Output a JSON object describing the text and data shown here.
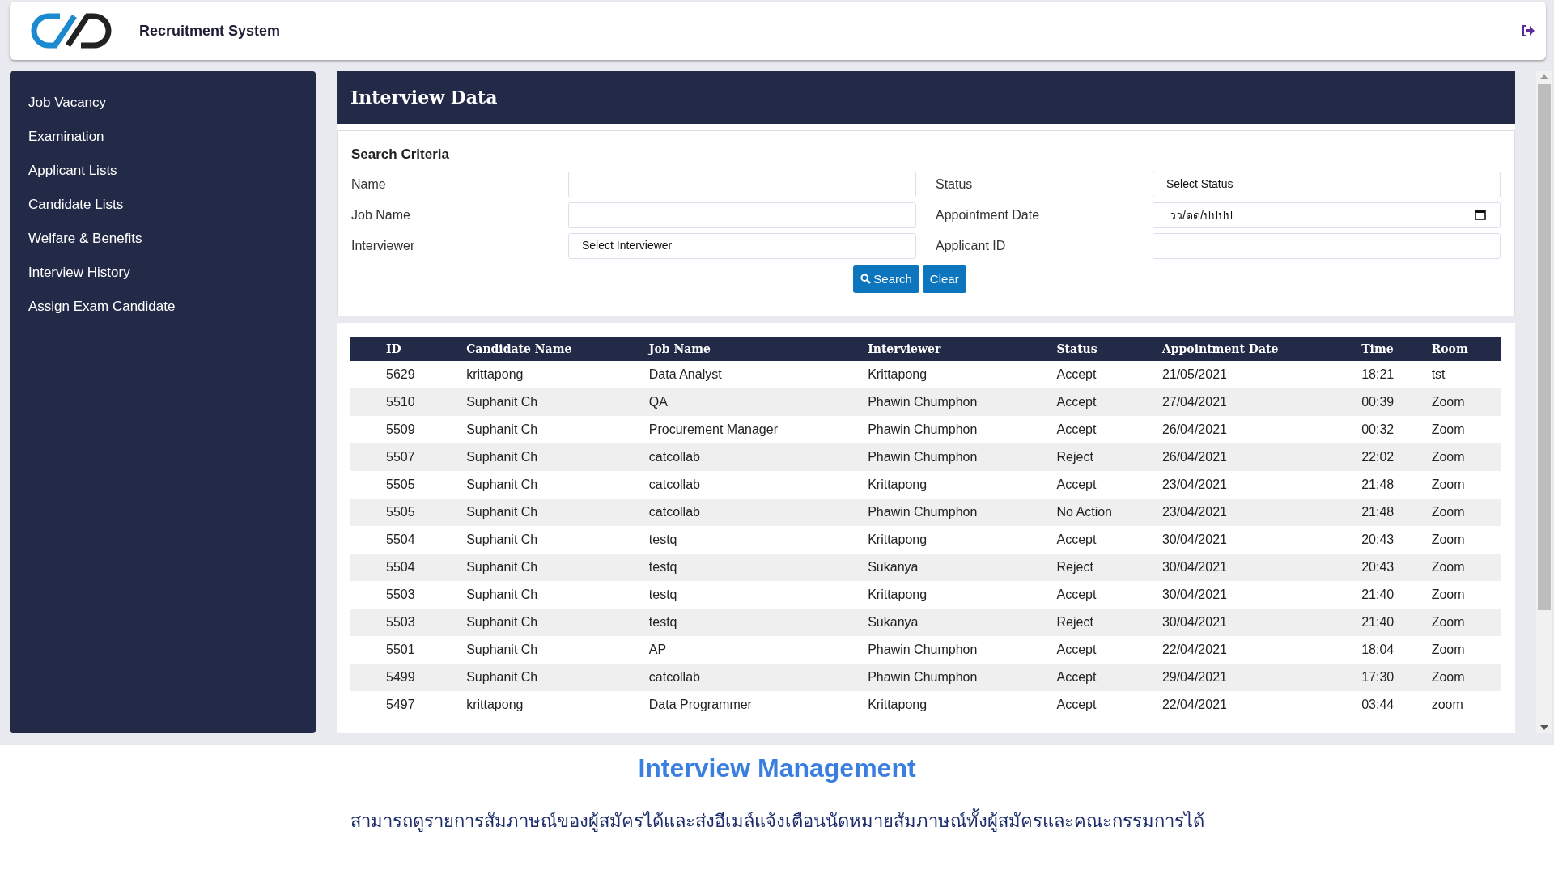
{
  "header": {
    "title": "Recruitment System"
  },
  "sidebar": {
    "items": [
      {
        "label": "Job Vacancy"
      },
      {
        "label": "Examination"
      },
      {
        "label": "Applicant Lists"
      },
      {
        "label": "Candidate Lists"
      },
      {
        "label": "Welfare & Benefits"
      },
      {
        "label": "Interview History"
      },
      {
        "label": "Assign Exam Candidate"
      }
    ]
  },
  "panel": {
    "title": "Interview Data"
  },
  "search": {
    "heading": "Search Criteria",
    "fields": [
      {
        "label": "Name",
        "kind": "text"
      },
      {
        "label": "Status",
        "kind": "select",
        "value": "Select Status"
      },
      {
        "label": "Job Name",
        "kind": "text"
      },
      {
        "label": "Appointment Date",
        "kind": "date",
        "placeholder": "วว/ดด/ปปปป"
      },
      {
        "label": "Interviewer",
        "kind": "select",
        "value": "Select Interviewer"
      },
      {
        "label": "Applicant ID",
        "kind": "text"
      }
    ],
    "buttons": [
      {
        "label": "Search",
        "kind": "search"
      },
      {
        "label": "Clear",
        "kind": "plain"
      }
    ]
  },
  "table": {
    "columns": [
      "ID",
      "Candidate Name",
      "Job Name",
      "Interviewer",
      "Status",
      "Appointment Date",
      "Time",
      "Room"
    ],
    "rows": [
      [
        "5629",
        "krittapong",
        "Data Analyst",
        "Krittapong",
        "Accept",
        "21/05/2021",
        "18:21",
        "tst"
      ],
      [
        "5510",
        "Suphanit Ch",
        "QA",
        "Phawin Chumphon",
        "Accept",
        "27/04/2021",
        "00:39",
        "Zoom"
      ],
      [
        "5509",
        "Suphanit Ch",
        "Procurement Manager",
        "Phawin Chumphon",
        "Accept",
        "26/04/2021",
        "00:32",
        "Zoom"
      ],
      [
        "5507",
        "Suphanit Ch",
        "catcollab",
        "Phawin Chumphon",
        "Reject",
        "26/04/2021",
        "22:02",
        "Zoom"
      ],
      [
        "5505",
        "Suphanit Ch",
        "catcollab",
        "Krittapong",
        "Accept",
        "23/04/2021",
        "21:48",
        "Zoom"
      ],
      [
        "5505",
        "Suphanit Ch",
        "catcollab",
        "Phawin Chumphon",
        "No Action",
        "23/04/2021",
        "21:48",
        "Zoom"
      ],
      [
        "5504",
        "Suphanit Ch",
        "testq",
        "Krittapong",
        "Accept",
        "30/04/2021",
        "20:43",
        "Zoom"
      ],
      [
        "5504",
        "Suphanit Ch",
        "testq",
        "Sukanya",
        "Reject",
        "30/04/2021",
        "20:43",
        "Zoom"
      ],
      [
        "5503",
        "Suphanit Ch",
        "testq",
        "Krittapong",
        "Accept",
        "30/04/2021",
        "21:40",
        "Zoom"
      ],
      [
        "5503",
        "Suphanit Ch",
        "testq",
        "Sukanya",
        "Reject",
        "30/04/2021",
        "21:40",
        "Zoom"
      ],
      [
        "5501",
        "Suphanit Ch",
        "AP",
        "Phawin Chumphon",
        "Accept",
        "22/04/2021",
        "18:04",
        "Zoom"
      ],
      [
        "5499",
        "Suphanit Ch",
        "catcollab",
        "Phawin Chumphon",
        "Accept",
        "29/04/2021",
        "17:30",
        "Zoom"
      ],
      [
        "5497",
        "krittapong",
        "Data Programmer",
        "Krittapong",
        "Accept",
        "22/04/2021",
        "03:44",
        "zoom"
      ]
    ]
  },
  "caption": {
    "title": "Interview Management",
    "description": "สามารถดูรายการสัมภาษณ์ของผู้สมัครได้และส่งอีเมล์แจ้งเตือนนัดหมายสัมภาษณ์ทั้งผู้สมัครและคณะกรรมการได้"
  }
}
